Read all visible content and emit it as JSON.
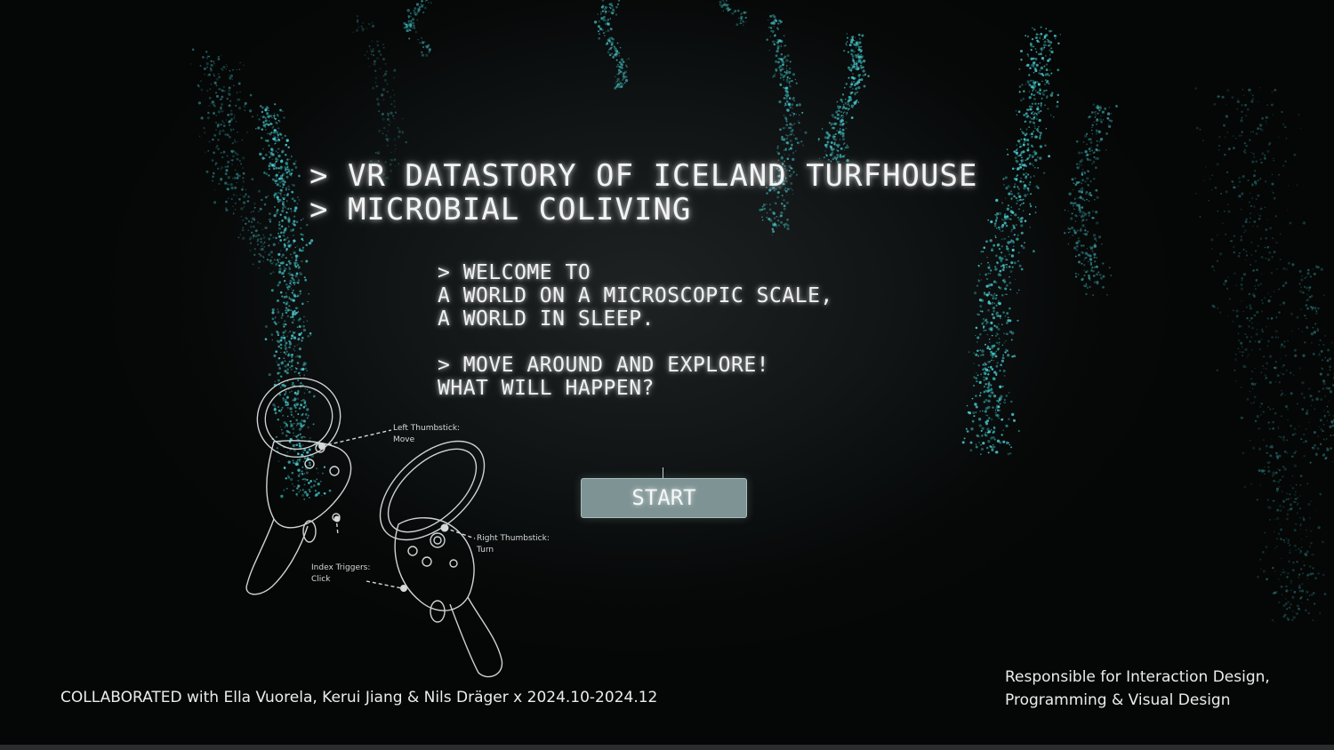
{
  "colors": {
    "particle": "#4fd0d8",
    "particle_dim": "#2aa7a0",
    "button_bg": "#7e9394",
    "text_glow": "#f2f4f4"
  },
  "title": {
    "line1": "> VR DATASTORY OF ICELAND TURFHOUSE",
    "line2": "> MICROBIAL COLIVING"
  },
  "intro": {
    "lines": [
      "> WELCOME TO",
      "A WORLD ON A MICROSCOPIC SCALE,",
      "A WORLD IN SLEEP.",
      "> MOVE AROUND AND EXPLORE!",
      "WHAT WILL HAPPEN?"
    ]
  },
  "start_button": {
    "label": "START"
  },
  "controller_guide": {
    "left_thumbstick_title": "Left Thumbstick:",
    "left_thumbstick_action": "Move",
    "right_thumbstick_title": "Right Thumbstick:",
    "right_thumbstick_action": "Turn",
    "index_triggers_title": "Index Triggers:",
    "index_triggers_action": "Click"
  },
  "footer": {
    "collaborated": "COLLABORATED with Ella Vuorela, Kerui Jiang & Nils Dräger x 2024.10-2024.12",
    "role_line1": "Responsible for Interaction Design,",
    "role_line2": "Programming & Visual Design"
  }
}
